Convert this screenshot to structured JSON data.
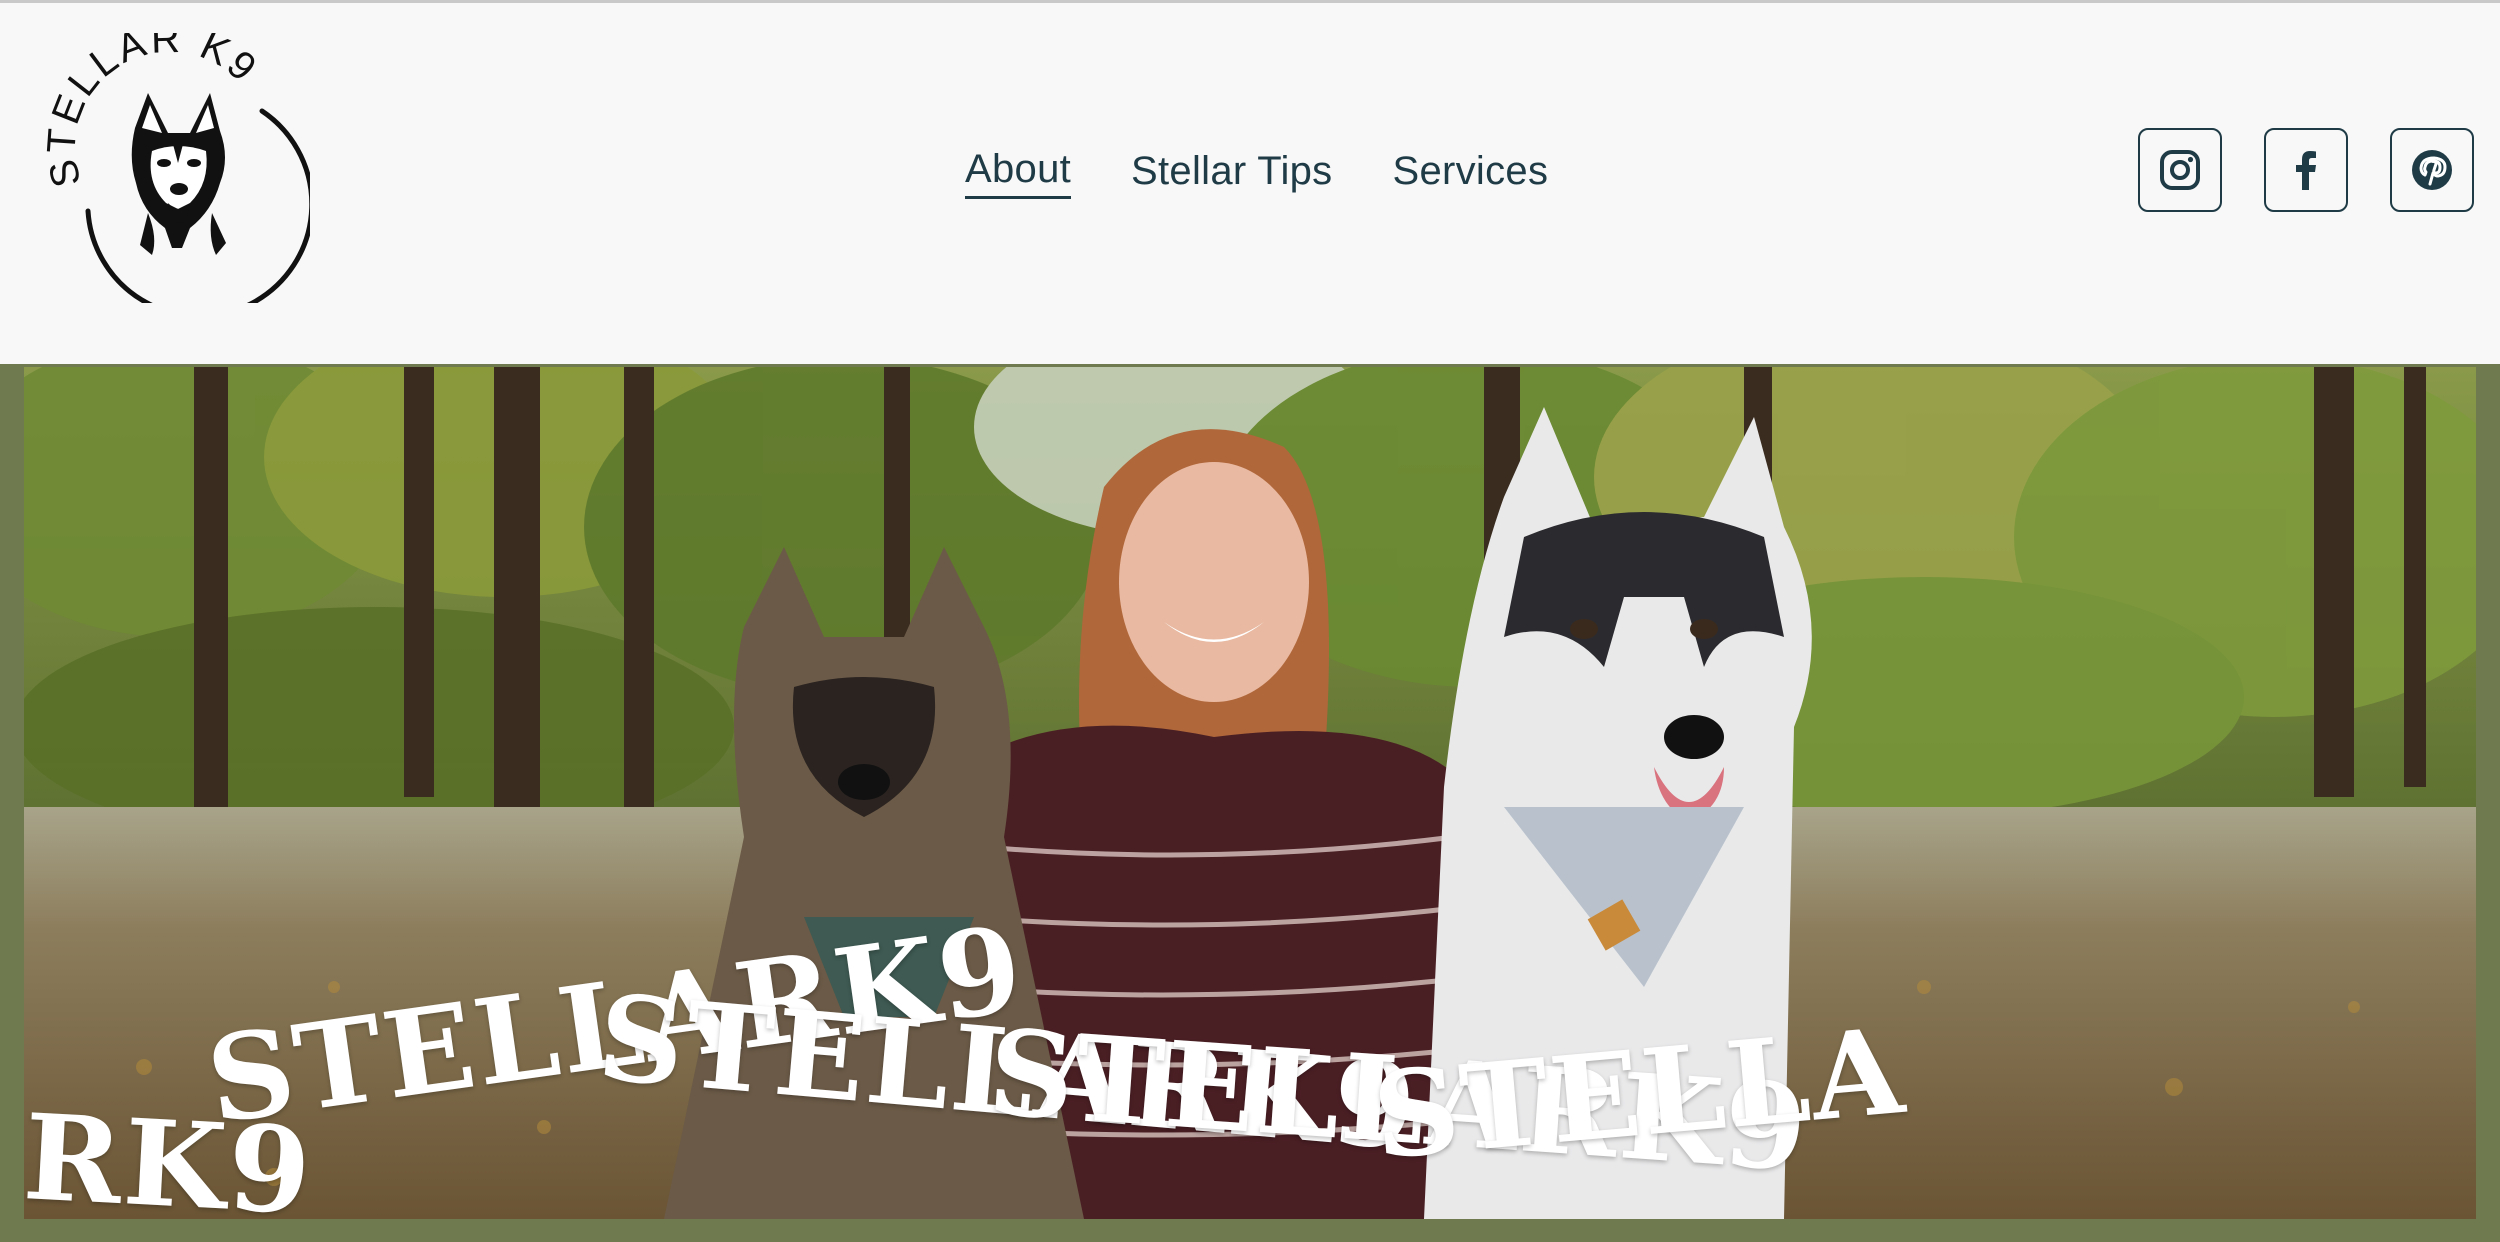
{
  "brand": {
    "logo_text": "STELLAR K9",
    "logo_icon": "husky-logo-icon"
  },
  "nav": {
    "items": [
      {
        "label": "About",
        "active": true
      },
      {
        "label": "Stellar Tips",
        "active": false
      },
      {
        "label": "Services",
        "active": false
      }
    ]
  },
  "social": [
    {
      "name": "instagram",
      "icon": "instagram-icon"
    },
    {
      "name": "facebook",
      "icon": "facebook-icon"
    },
    {
      "name": "pinterest",
      "icon": "pinterest-icon"
    }
  ],
  "hero": {
    "marquee": [
      "RK9",
      "STELLARK9",
      "STELLARK9",
      "STELLARK9",
      "STELLA"
    ]
  },
  "colors": {
    "header_bg": "#f8f8f8",
    "nav_text": "#1f3b46",
    "frame": "#6f7a4f",
    "marquee_text": "#ffffff"
  }
}
